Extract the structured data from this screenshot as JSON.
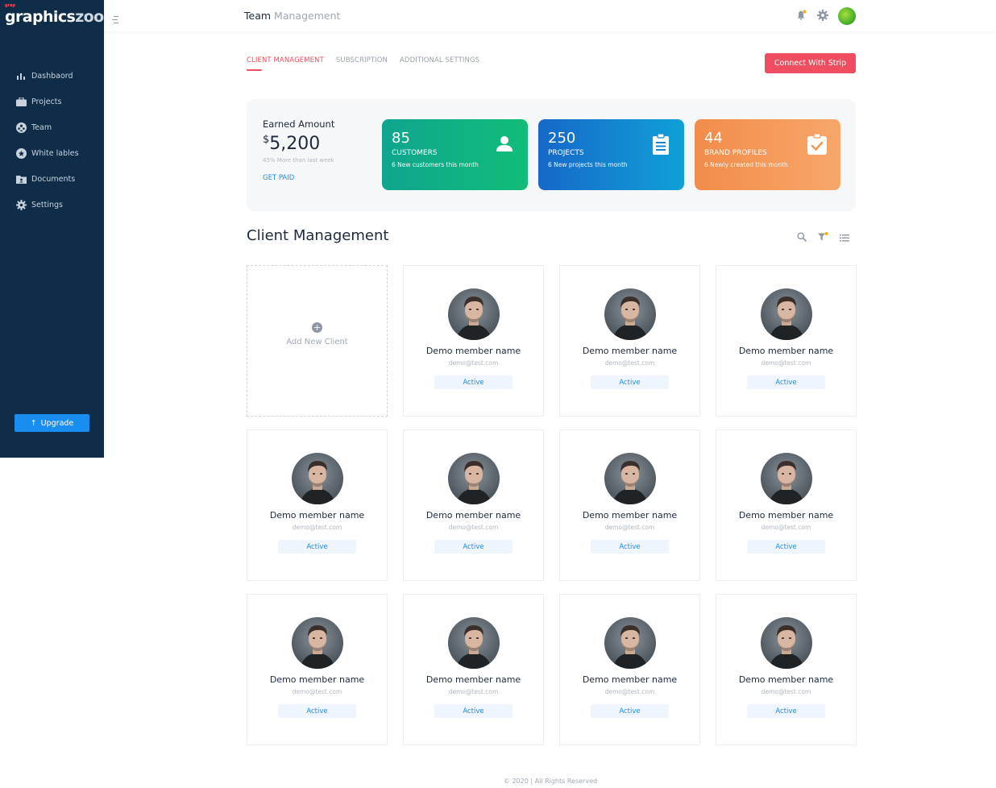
{
  "app": {
    "logo_text": "graphics",
    "logo_text_suffix": "zoo",
    "logo_tag": "grap"
  },
  "sidebar": {
    "items": [
      {
        "label": "Dashbaord",
        "icon": "bar-chart-icon"
      },
      {
        "label": "Projects",
        "icon": "briefcase-icon"
      },
      {
        "label": "Team",
        "icon": "team-icon"
      },
      {
        "label": "White lables",
        "icon": "badge-icon"
      },
      {
        "label": "Documents",
        "icon": "folder-icon"
      },
      {
        "label": "Settings",
        "icon": "gear-icon"
      }
    ],
    "upgrade_label": "Upgrade"
  },
  "header": {
    "title": "Team",
    "subtitle": "Management"
  },
  "tabs": [
    {
      "label": "CLIENT MANAGEMENT",
      "active": true
    },
    {
      "label": "SUBSCRIPTION",
      "active": false
    },
    {
      "label": "ADDITIONAL SETTINGS",
      "active": false
    }
  ],
  "connect_button": "Connect With Strip",
  "earned": {
    "label": "Earned Amount",
    "currency": "$",
    "amount": "5,200",
    "note": "45% More than last week",
    "action": "GET PAID"
  },
  "stats": [
    {
      "value": "85",
      "caption": "CUSTOMERS",
      "detail": "6 New customers this month",
      "icon": "user-icon",
      "color": "#11b585"
    },
    {
      "value": "250",
      "caption": "PROJECTS",
      "detail": "6 New projects this month",
      "icon": "clipboard-icon",
      "color": "#1484d0"
    },
    {
      "value": "44",
      "caption": "BRAND PROFILES",
      "detail": "6 Newly created this month",
      "icon": "clipboard-check-icon",
      "color": "#f49858"
    }
  ],
  "section": {
    "title": "Client Management"
  },
  "add_client_label": "Add New Client",
  "members": [
    {
      "name": "Demo member name",
      "email": "demo@test.com",
      "status": "Active"
    },
    {
      "name": "Demo member name",
      "email": "demo@test.com",
      "status": "Active"
    },
    {
      "name": "Demo member name",
      "email": "demo@test.com",
      "status": "Active"
    },
    {
      "name": "Demo member name",
      "email": "demo@test.com",
      "status": "Active"
    },
    {
      "name": "Demo member name",
      "email": "demo@test.com",
      "status": "Active"
    },
    {
      "name": "Demo member name",
      "email": "demo@test.com",
      "status": "Active"
    },
    {
      "name": "Demo member name",
      "email": "demo@test.com",
      "status": "Active"
    },
    {
      "name": "Demo member name",
      "email": "demo@test.com",
      "status": "Active"
    },
    {
      "name": "Demo member name",
      "email": "demo@test.com",
      "status": "Active"
    },
    {
      "name": "Demo member name",
      "email": "demo@test.com",
      "status": "Active"
    },
    {
      "name": "Demo member name",
      "email": "demo@test.com",
      "status": "Active"
    }
  ],
  "footer": "© 2020 | All Rights Reserved"
}
